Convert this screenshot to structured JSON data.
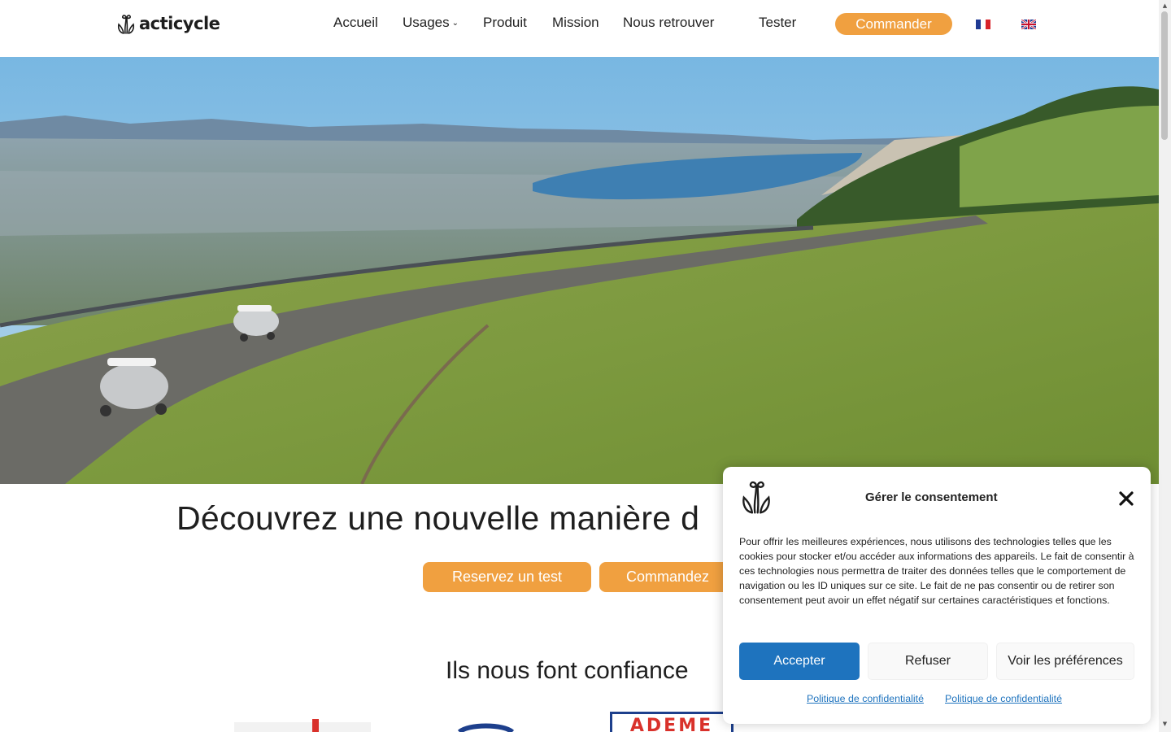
{
  "header": {
    "logo_text": "acticycle",
    "nav": {
      "accueil": "Accueil",
      "usages": "Usages",
      "produit": "Produit",
      "mission": "Mission",
      "nous_retrouver": "Nous retrouver",
      "tester": "Tester"
    },
    "commander_label": "Commander",
    "languages": [
      "fr",
      "en"
    ]
  },
  "hero": {
    "image_alt": ""
  },
  "main": {
    "headline": "Découvrez une nouvelle manière d",
    "cta_test": "Reservez un test",
    "cta_commandez": "Commandez",
    "trust_title": "Ils nous font confiance",
    "partner_ademe": "ADEME"
  },
  "consent": {
    "title": "Gérer le consentement",
    "body": "Pour offrir les meilleures expériences, nous utilisons des technologies telles que les cookies pour stocker et/ou accéder aux informations des appareils. Le fait de consentir à ces technologies nous permettra de traiter des données telles que le comportement de navigation ou les ID uniques sur ce site. Le fait de ne pas consentir ou de retirer son consentement peut avoir un effet négatif sur certaines caractéristiques et fonctions.",
    "accept": "Accepter",
    "refuse": "Refuser",
    "preferences": "Voir les préférences",
    "link_1": "Politique de confidentialité",
    "link_2": "Politique de confidentialité"
  },
  "colors": {
    "accent_orange": "#f0a040",
    "accept_blue": "#1e73be",
    "text_dark": "#1f1f1f"
  },
  "icons": [
    "acticycle-logo-icon",
    "chevron-down-icon",
    "flag-fr-icon",
    "flag-en-icon",
    "close-icon"
  ]
}
